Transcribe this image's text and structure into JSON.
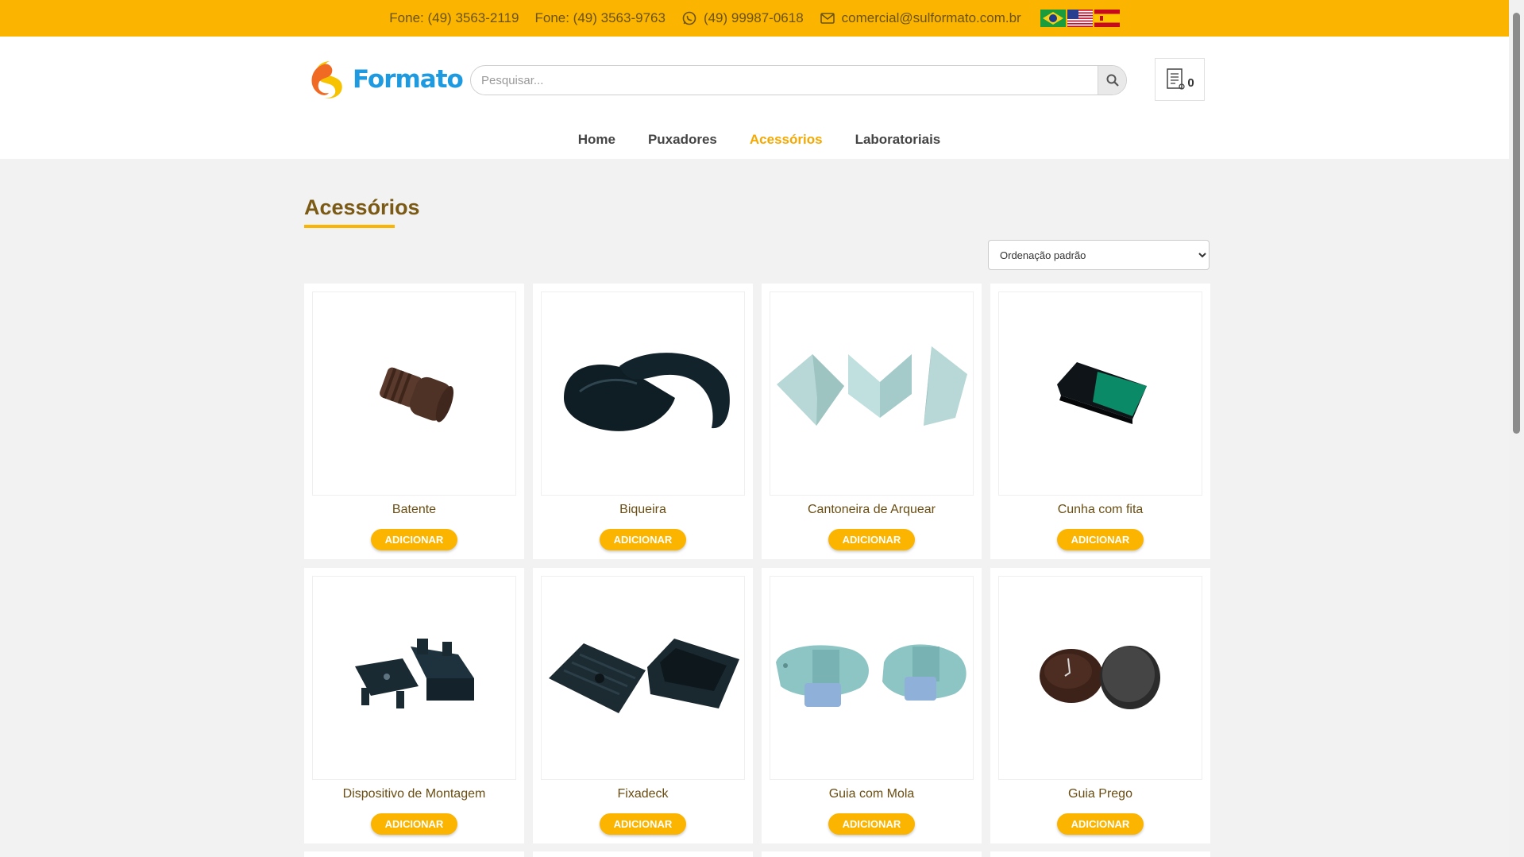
{
  "topbar": {
    "phone1": "Fone: (49) 3563-2119",
    "phone2": "Fone: (49) 3563-9763",
    "whatsapp": "(49) 99987-0618",
    "email": "comercial@sulformato.com.br",
    "flags": [
      "brazil-flag",
      "usa-flag",
      "spain-flag"
    ],
    "color": "#fbb400"
  },
  "header": {
    "logo_text": "Formato",
    "search_placeholder": "Pesquisar...",
    "cart_count": "0"
  },
  "nav": {
    "items": [
      "Home",
      "Puxadores",
      "Acessórios",
      "Laboratoriais"
    ],
    "active": "Acessórios"
  },
  "page": {
    "title": "Acessórios",
    "sort_selected": "Ordenação padrão"
  },
  "products": [
    {
      "name": "Batente",
      "button": "ADICIONAR",
      "icon": "batente-image"
    },
    {
      "name": "Biqueira",
      "button": "ADICIONAR",
      "icon": "biqueira-image"
    },
    {
      "name": "Cantoneira de Arquear",
      "button": "ADICIONAR",
      "icon": "cantoneira-image"
    },
    {
      "name": "Cunha com fita",
      "button": "ADICIONAR",
      "icon": "cunha-image"
    },
    {
      "name": "Dispositivo de Montagem",
      "button": "ADICIONAR",
      "icon": "dispositivo-image"
    },
    {
      "name": "Fixadeck",
      "button": "ADICIONAR",
      "icon": "fixadeck-image"
    },
    {
      "name": "Guia com Mola",
      "button": "ADICIONAR",
      "icon": "guia-mola-image"
    },
    {
      "name": "Guia Prego",
      "button": "ADICIONAR",
      "icon": "guia-prego-image"
    }
  ],
  "colors": {
    "accent": "#fbb400",
    "title": "#7a5a14",
    "logo_blue": "#1e9be0"
  }
}
